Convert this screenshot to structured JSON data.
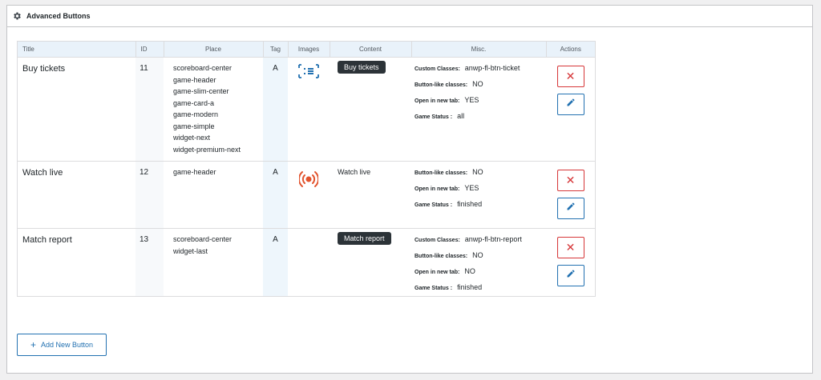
{
  "panel": {
    "title": "Advanced Buttons",
    "icon": "gear-icon"
  },
  "table": {
    "headers": [
      "Title",
      "ID",
      "Place",
      "Tag",
      "Images",
      "Content",
      "Misc.",
      "Actions"
    ],
    "rows": [
      {
        "title": "Buy tickets",
        "id": "11",
        "places": [
          "scoreboard-center",
          "game-header",
          "game-slim-center",
          "game-card-a",
          "game-modern",
          "game-simple",
          "widget-next",
          "widget-premium-next"
        ],
        "tag": "A",
        "image": "ticket-icon",
        "content": "Buy tickets",
        "content_style": "pill",
        "misc": [
          {
            "key": "Custom Classes:",
            "value": "anwp-fl-btn-ticket"
          },
          {
            "key": "Button-like classes:",
            "value": "NO"
          },
          {
            "key": "Open in new tab:",
            "value": "YES"
          },
          {
            "key": "Game Status :",
            "value": "all"
          }
        ]
      },
      {
        "title": "Watch live",
        "id": "12",
        "places": [
          "game-header"
        ],
        "tag": "A",
        "image": "broadcast-icon",
        "content": "Watch live",
        "content_style": "plain",
        "misc": [
          {
            "key": "Button-like classes:",
            "value": "NO"
          },
          {
            "key": "Open in new tab:",
            "value": "YES"
          },
          {
            "key": "Game Status :",
            "value": "finished"
          }
        ]
      },
      {
        "title": "Match report",
        "id": "13",
        "places": [
          "scoreboard-center",
          "widget-last"
        ],
        "tag": "A",
        "image": "",
        "content": "Match report",
        "content_style": "pill",
        "misc": [
          {
            "key": "Custom Classes:",
            "value": "anwp-fl-btn-report"
          },
          {
            "key": "Button-like classes:",
            "value": "NO"
          },
          {
            "key": "Open in new tab:",
            "value": "NO"
          },
          {
            "key": "Game Status :",
            "value": "finished"
          }
        ]
      }
    ]
  },
  "actions": {
    "delete_icon": "close-icon",
    "edit_icon": "pencil-icon"
  },
  "add_button": {
    "label": "Add New Button"
  },
  "colors": {
    "delete": "#d63638",
    "edit": "#2271b1",
    "pill_bg": "#2c3338",
    "broadcast": "#e2532d",
    "ticket": "#2271b1"
  }
}
